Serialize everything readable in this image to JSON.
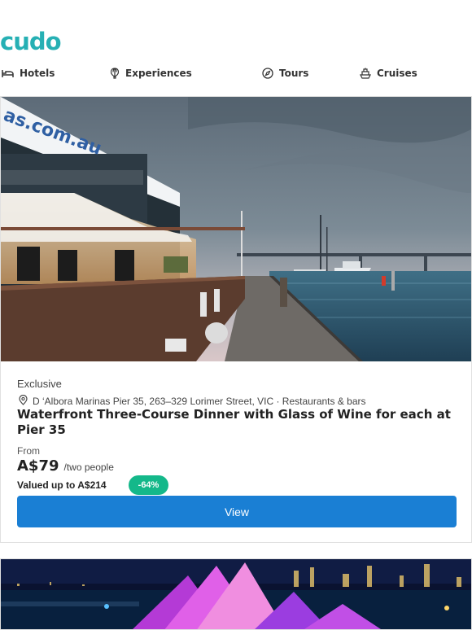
{
  "brand": {
    "logo_text": "cudo",
    "color": "#26b0b4"
  },
  "nav": {
    "items": [
      {
        "label": "Hotels",
        "icon": "bed-icon"
      },
      {
        "label": "Experiences",
        "icon": "balloon-icon"
      },
      {
        "label": "Tours",
        "icon": "compass-icon"
      },
      {
        "label": "Cruises",
        "icon": "ship-icon"
      }
    ]
  },
  "deal": {
    "hero_sign_text": "as.com.au",
    "tag": "Exclusive",
    "location": "D ‘Albora Marinas Pier 35, 263–329 Lorimer Street, VIC · Restaurants & bars",
    "title": "Waterfront Three-Course Dinner with Glass of Wine for each at Pier 35",
    "from_label": "From",
    "price": "A$79",
    "price_unit": "/two people",
    "valued": "Valued up to A$214",
    "discount": "-64%",
    "view_label": "View"
  },
  "colors": {
    "accent": "#1a7fd4",
    "badge": "#14b88a",
    "brand": "#26b0b4"
  }
}
